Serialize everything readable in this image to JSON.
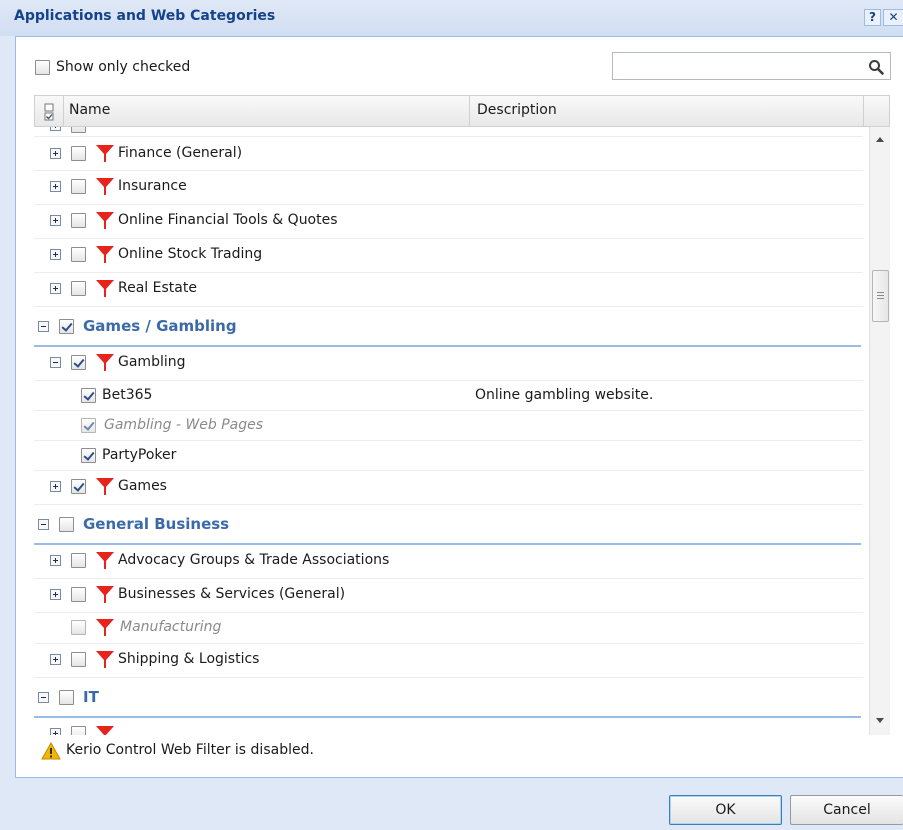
{
  "window": {
    "title": "Applications and Web Categories",
    "help_label": "?",
    "close_label": "✕"
  },
  "toolbar": {
    "show_only_checked_label": "Show only checked",
    "show_only_checked": false,
    "search": {
      "value": "",
      "placeholder": ""
    }
  },
  "grid": {
    "columns": [
      "Name",
      "Description"
    ],
    "rows": {
      "finance_general": {
        "name": "Finance (General)",
        "checked": false,
        "description": ""
      },
      "insurance": {
        "name": "Insurance",
        "checked": false,
        "description": ""
      },
      "online_financial_tools": {
        "name": "Online Financial Tools & Quotes",
        "checked": false,
        "description": ""
      },
      "online_stock_trading": {
        "name": "Online Stock Trading",
        "checked": false,
        "description": ""
      },
      "real_estate": {
        "name": "Real Estate",
        "checked": false,
        "description": ""
      },
      "games_gambling_group": {
        "name": "Games / Gambling",
        "checked": true
      },
      "gambling": {
        "name": "Gambling",
        "checked": true
      },
      "bet365": {
        "name": "Bet365",
        "checked": true,
        "description": "Online gambling website."
      },
      "gambling_web_pages": {
        "name": "Gambling - Web Pages",
        "checked": true,
        "description": ""
      },
      "partypoker": {
        "name": "PartyPoker",
        "checked": true,
        "description": ""
      },
      "games": {
        "name": "Games",
        "checked": true
      },
      "general_business_group": {
        "name": "General Business",
        "checked": false
      },
      "advocacy": {
        "name": "Advocacy Groups & Trade Associations",
        "checked": false
      },
      "businesses_services": {
        "name": "Businesses & Services (General)",
        "checked": false
      },
      "manufacturing": {
        "name": "Manufacturing",
        "checked": false
      },
      "shipping": {
        "name": "Shipping & Logistics",
        "checked": false
      },
      "it_group": {
        "name": "IT",
        "checked": false
      }
    }
  },
  "status": {
    "warning_text": "Kerio Control Web Filter is disabled."
  },
  "buttons": {
    "ok_label": "OK",
    "cancel_label": "Cancel"
  },
  "colors": {
    "title_text": "#15428b",
    "group_text": "#3a6aa8",
    "filter_icon": "#e8231c",
    "warning_icon": "#f2b705"
  }
}
